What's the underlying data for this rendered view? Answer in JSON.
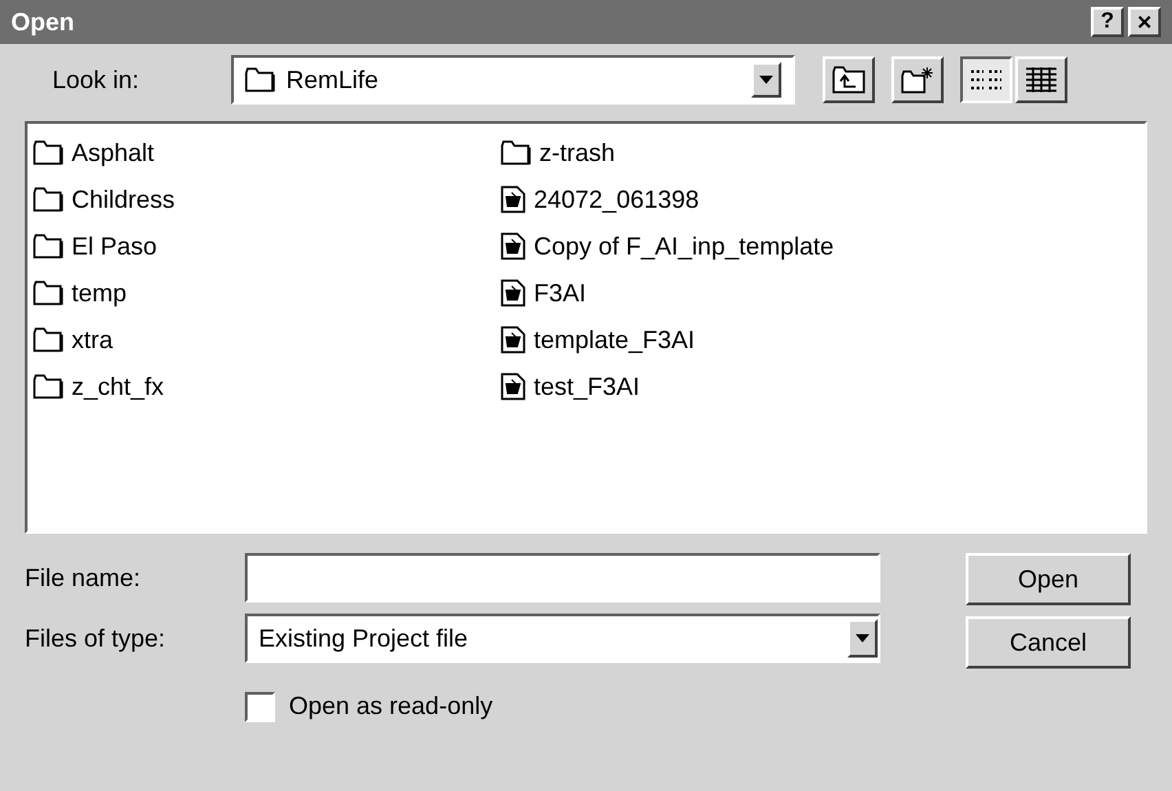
{
  "window": {
    "title": "Open",
    "help": "?",
    "close": "×"
  },
  "look_in": {
    "label": "Look in:",
    "value": "RemLife"
  },
  "files": [
    {
      "name": "Asphalt",
      "kind": "folder"
    },
    {
      "name": "Childress",
      "kind": "folder"
    },
    {
      "name": "El Paso",
      "kind": "folder"
    },
    {
      "name": "temp",
      "kind": "folder"
    },
    {
      "name": "xtra",
      "kind": "folder"
    },
    {
      "name": "z_cht_fx",
      "kind": "folder"
    },
    {
      "name": "z-trash",
      "kind": "folder"
    },
    {
      "name": "24072_061398",
      "kind": "file"
    },
    {
      "name": "Copy of F_AI_inp_template",
      "kind": "file"
    },
    {
      "name": "F3AI",
      "kind": "file"
    },
    {
      "name": "template_F3AI",
      "kind": "file"
    },
    {
      "name": "test_F3AI",
      "kind": "file"
    }
  ],
  "file_name": {
    "label": "File name:"
  },
  "file_type": {
    "label": "Files of type:",
    "value": "Existing Project file"
  },
  "read_only": {
    "label": "Open as read-only",
    "checked": false
  },
  "buttons": [
    "Open",
    "Cancel"
  ]
}
